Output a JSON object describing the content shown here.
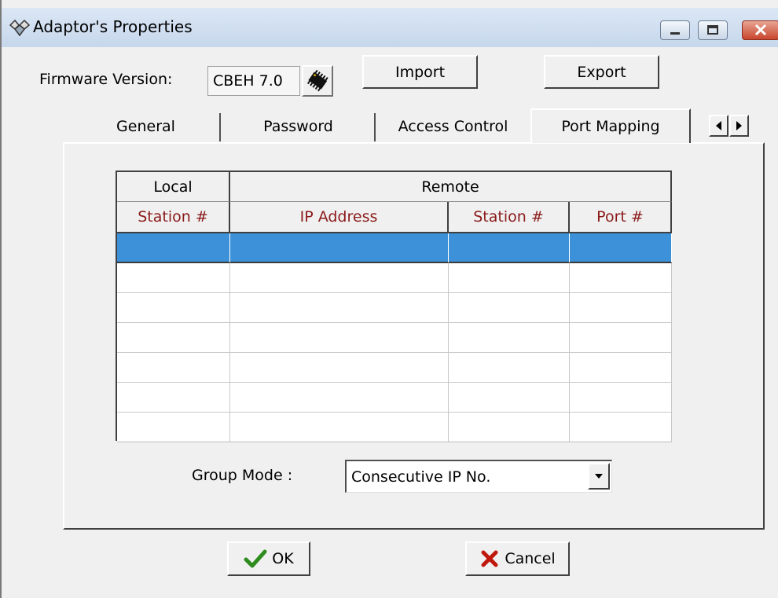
{
  "window": {
    "title": "Adaptor's Properties",
    "icon": "adaptor-icon",
    "controls": [
      "minimize-icon",
      "maximize-icon",
      "close-icon"
    ]
  },
  "firmware": {
    "label": "Firmware Version:",
    "value": "CBEH 7.0",
    "chip_icon": "chip-icon",
    "import_label": "Import",
    "export_label": "Export"
  },
  "tabs": [
    {
      "label": "General",
      "active": false
    },
    {
      "label": "Password",
      "active": false
    },
    {
      "label": "Access Control",
      "active": false
    },
    {
      "label": "Port Mapping",
      "active": true
    }
  ],
  "tab_scroll": [
    "arrow-left-icon",
    "arrow-right-icon"
  ],
  "grid": {
    "group_headers": [
      "Local",
      "Remote"
    ],
    "columns": [
      "Station #",
      "IP Address",
      "Station #",
      "Port #"
    ],
    "rows": [
      [
        "",
        "",
        "",
        ""
      ],
      [
        "",
        "",
        "",
        ""
      ],
      [
        "",
        "",
        "",
        ""
      ],
      [
        "",
        "",
        "",
        ""
      ],
      [
        "",
        "",
        "",
        ""
      ],
      [
        "",
        "",
        "",
        ""
      ],
      [
        "",
        "",
        "",
        ""
      ]
    ],
    "selected_row": 0,
    "selection_color": "#3c91d8",
    "header_text_color": "#8b1a1a"
  },
  "group_mode": {
    "label": "Group Mode :",
    "value": "Consecutive IP No."
  },
  "footer": {
    "ok_label": "OK",
    "cancel_label": "Cancel",
    "ok_icon": "checkmark-icon",
    "cancel_icon": "x-icon"
  }
}
